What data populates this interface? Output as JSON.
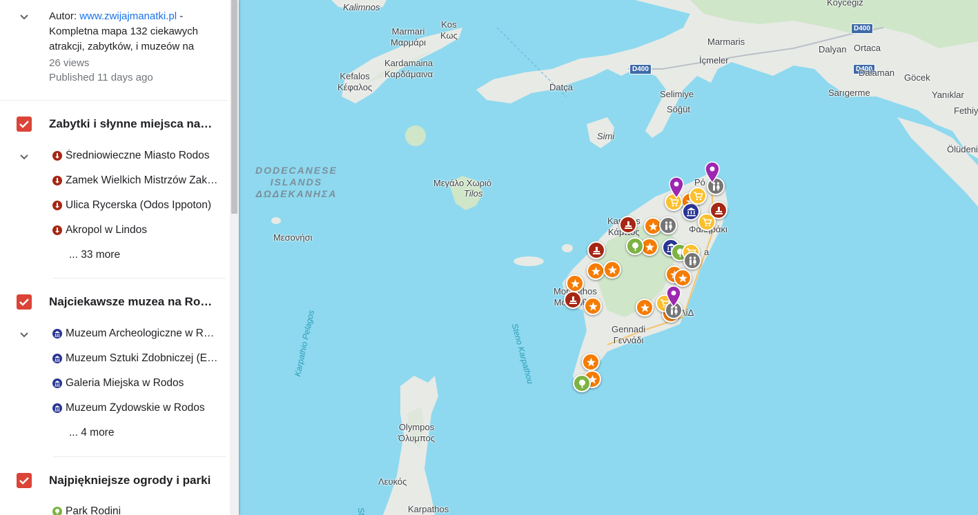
{
  "map": {
    "labels": {
      "kalimnos": "Kalimnos",
      "kos": "Kos",
      "kos_greek": "Κως",
      "marmari": "Marmari",
      "marmari_greek": "Μαρμάρι",
      "kardamaina": "Kardamaina",
      "kardamaina_greek": "Καρδάμαινα",
      "kefalos": "Kefalos",
      "kefalos_greek": "Κέφαλος",
      "datca": "Datça",
      "marmaris": "Marmaris",
      "icmeler": "İçmeler",
      "selimiye": "Selimiye",
      "sogut": "Söğüt",
      "simi": "Simi",
      "koycegiz": "Köycegiz",
      "dalyan": "Dalyan",
      "ortaca": "Ortaca",
      "dalaman": "Dalaman",
      "gocek": "Göcek",
      "sarigerme": "Sarıgerme",
      "yaniklar": "Yanıklar",
      "fethiye": "Fethiy",
      "oludeniz": "Ölüdeni",
      "dodecanese_1": "DODECANESE",
      "dodecanese_2": "ISLANDS",
      "dodecanese_3": "ΔΩΔΕΚΑΝΗΣΑ",
      "megalo_chorio": "Μεγάλο Χωριό",
      "tilos": "Tilos",
      "mesonisi": "Μεσονήσι",
      "karpathio_pelagos": "Karpathio Pelagos",
      "steno_karpathou": "Steno Karpathou",
      "kampos": "Κάμπος",
      "kampos_latin": "Kampos",
      "monolithos_1": "Monolithos",
      "monolithos_2": "Μονόλιθος",
      "gennadi": "Gennadi",
      "gennadi_greek": "Γεννάδι",
      "faliraki": "Φαληράκι",
      "olympos": "Olympos",
      "olympos_greek": "Όλυμπος",
      "lefkos": "Λευκός",
      "karpathos": "Karpathos",
      "rhodes_partial": "Ρό",
      "lindos_partial": "ΛίΔ",
      "afantou_partial": "a",
      "stenos_partial": "Ste"
    },
    "roads": [
      "D400",
      "D400",
      "D400"
    ],
    "markers": [
      {
        "kind": "museum",
        "color": "#283593",
        "icon": "museum-icon"
      },
      {
        "kind": "monument",
        "color": "#a52714",
        "icon": "monument-icon"
      },
      {
        "kind": "attraction",
        "color": "#f57c00",
        "icon": "star-icon"
      },
      {
        "kind": "garden",
        "color": "#7cb342",
        "icon": "tree-icon"
      },
      {
        "kind": "shopping",
        "color": "#fbc02d",
        "icon": "cart-icon"
      },
      {
        "kind": "toilet",
        "color": "#757575",
        "icon": "people-icon"
      },
      {
        "kind": "pin",
        "color": "#9c27b0",
        "icon": "pin-icon"
      }
    ]
  },
  "sidebar": {
    "meta": {
      "author_prefix": "Autor:",
      "author_link": "www.zwijajmanatki.pl",
      "author_suffix": " -",
      "description": "Kompletna mapa 132 ciekawych atrakcji, zabytków, i muzeów na",
      "views": "26 views",
      "published": "Published 11 days ago"
    },
    "layers": [
      {
        "title": "Zabytki i słynne miejsca na Rodos",
        "icon_color": "#a52714",
        "icon": "monument-icon",
        "items": [
          "Średniowieczne Miasto Rodos",
          "Zamek Wielkich Mistrzów Zakonu Joannitów",
          "Ulica Rycerska (Odos Ippoton)",
          "Akropol w Lindos"
        ],
        "more": "... 33 more"
      },
      {
        "title": "Najciekawsze muzea na Rodos",
        "icon_color": "#283593",
        "icon": "museum-icon",
        "items": [
          "Muzeum Archeologiczne w Rodos",
          "Muzeum Sztuki Zdobniczej (Etnograficzne)",
          "Galeria Miejska w Rodos",
          "Muzeum Żydowskie w Rodos"
        ],
        "more": "... 4 more"
      },
      {
        "title": "Najpiękniejsze ogrody i parki",
        "icon_color": "#7cb342",
        "icon": "tree-icon",
        "items": [
          "Park Rodini"
        ]
      }
    ]
  }
}
